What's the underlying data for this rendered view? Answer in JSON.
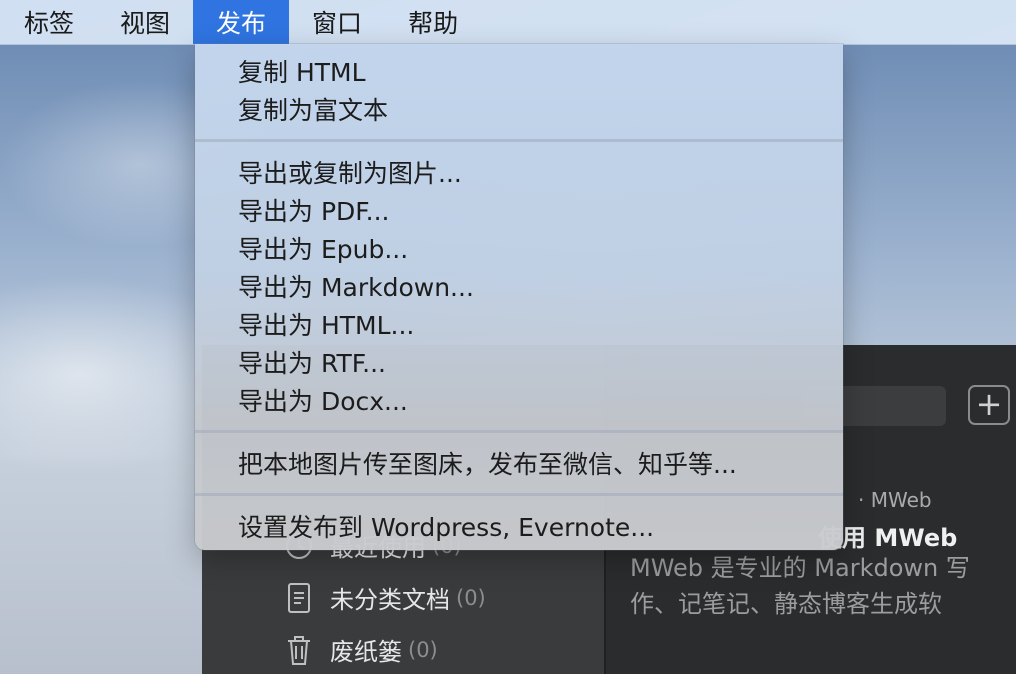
{
  "menubar": {
    "items": [
      "标签",
      "视图",
      "发布",
      "窗口",
      "帮助"
    ],
    "active_index": 2
  },
  "publish_menu": {
    "group1": [
      "复制 HTML",
      "复制为富文本"
    ],
    "group2": [
      "导出或复制为图片...",
      "导出为 PDF...",
      "导出为 Epub...",
      "导出为 Markdown...",
      "导出为 HTML...",
      "导出为 RTF...",
      "导出为 Docx..."
    ],
    "group3": [
      "把本地图片传至图床，发布至微信、知乎等..."
    ],
    "group4": [
      "设置发布到 Wordpress, Evernote..."
    ]
  },
  "app": {
    "sidebar": {
      "recent_label": "最近使用",
      "recent_count": "(0)",
      "uncategorized_label": "未分类文档",
      "uncategorized_count": "(0)",
      "trash_label": "废纸篓",
      "trash_count": "(0)"
    },
    "add_button_label": "+",
    "note": {
      "meta": "· MWeb",
      "title": "使用 MWeb",
      "excerpt": "MWeb 是专业的 Markdown 写作、记笔记、静态博客生成软"
    }
  },
  "colors": {
    "menu_highlight": "#2f74e0",
    "app_background": "#2e2f31"
  }
}
